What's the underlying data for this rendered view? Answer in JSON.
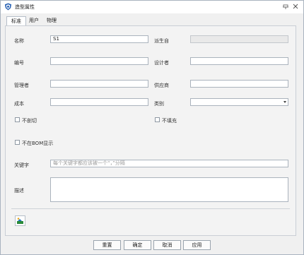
{
  "window": {
    "title": "造型属性",
    "icon": "shield-app-icon"
  },
  "titlebar_buttons": [
    "pin-icon",
    "close-icon"
  ],
  "tabs": [
    {
      "label": "标准",
      "active": true
    },
    {
      "label": "用户",
      "active": false
    },
    {
      "label": "物理",
      "active": false
    }
  ],
  "form": {
    "name": {
      "label": "名称",
      "value": "S1"
    },
    "derived": {
      "label": "派生自",
      "value": ""
    },
    "number": {
      "label": "编号",
      "value": ""
    },
    "designer": {
      "label": "设计者",
      "value": ""
    },
    "manager": {
      "label": "管理者",
      "value": ""
    },
    "supplier": {
      "label": "供应商",
      "value": ""
    },
    "cost": {
      "label": "成本",
      "value": ""
    },
    "category": {
      "label": "类别",
      "value": ""
    },
    "no_cut": {
      "label": "不剖切",
      "checked": false
    },
    "no_fill": {
      "label": "不填充",
      "checked": false
    },
    "not_in_bom": {
      "label": "不在BOM显示",
      "checked": false
    },
    "keywords": {
      "label": "关键字",
      "placeholder": "每个关键字都应该被一个“，”分隔",
      "value": ""
    },
    "description": {
      "label": "描述",
      "value": ""
    }
  },
  "tool_button_icon": "add-image-icon",
  "buttons": {
    "reset": "重置",
    "ok": "确定",
    "cancel": "取消",
    "apply": "应用"
  },
  "colors": {
    "accent": "#1a6fc0",
    "frame": "#a9b3bf"
  }
}
